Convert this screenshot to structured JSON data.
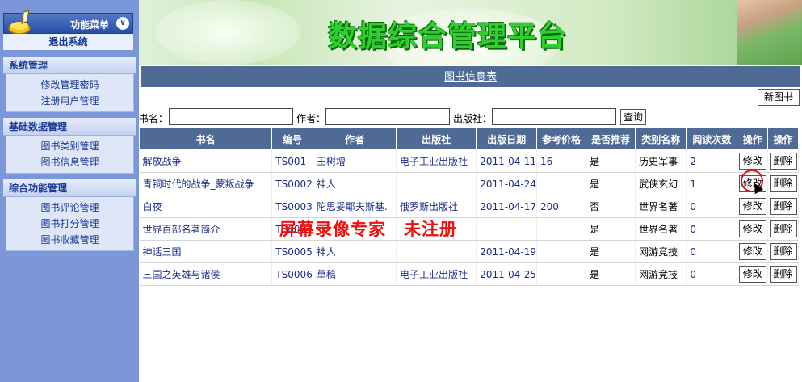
{
  "sidebar": {
    "menu_title": "功能菜单",
    "toggle_icon": "chevron-double-down",
    "logout_label": "退出系统",
    "sections": [
      {
        "title": "系统管理",
        "items": [
          "修改管理密码",
          "注册用户管理"
        ]
      },
      {
        "title": "基础数据管理",
        "items": [
          "图书类别管理",
          "图书信息管理"
        ]
      },
      {
        "title": "综合功能管理",
        "items": [
          "图书评论管理",
          "图书打分管理",
          "图书收藏管理"
        ]
      }
    ]
  },
  "banner": {
    "title": "数据综合管理平台"
  },
  "main": {
    "table_title": "图书信息表",
    "new_button_label": "新图书",
    "search": {
      "name_label": "书名：",
      "author_label": "作者：",
      "publisher_label": "出版社：",
      "name_value": "",
      "author_value": "",
      "publisher_value": "",
      "query_button_label": "查询"
    },
    "columns": [
      "书名",
      "编号",
      "作者",
      "出版社",
      "出版日期",
      "参考价格",
      "是否推荐",
      "类别名称",
      "阅读次数",
      "操作",
      "操作"
    ],
    "edit_label": "修改",
    "delete_label": "删除",
    "rows": [
      {
        "name": "解放战争",
        "id": "TS001",
        "author": "王树增",
        "publisher": "电子工业出版社",
        "date": "2011-04-11",
        "price": "16",
        "recommended": "是",
        "category": "历史军事",
        "reads": "2"
      },
      {
        "name": "青铜时代的战争_蒙叛战争",
        "id": "TS0002",
        "author": "神人",
        "publisher": "",
        "date": "2011-04-24",
        "price": "",
        "recommended": "是",
        "category": "武侠玄幻",
        "reads": "1"
      },
      {
        "name": "白夜",
        "id": "TS0003",
        "author": "陀思妥耶夫斯基.",
        "publisher": "俄罗斯出版社",
        "date": "2011-04-17",
        "price": "200",
        "recommended": "否",
        "category": "世界名著",
        "reads": "0"
      },
      {
        "name": "世界百部名著简介",
        "id": "TS0004",
        "author": "",
        "publisher": "",
        "date": "",
        "price": "",
        "recommended": "是",
        "category": "世界名著",
        "reads": "0"
      },
      {
        "name": "神话三国",
        "id": "TS0005",
        "author": "神人",
        "publisher": "",
        "date": "2011-04-19",
        "price": "",
        "recommended": "是",
        "category": "网游竞技",
        "reads": "0"
      },
      {
        "name": "三国之英雄与诸侯",
        "id": "TS0006",
        "author": "草稿",
        "publisher": "电子工业出版社",
        "date": "2011-04-25",
        "price": "",
        "recommended": "是",
        "category": "网游竞技",
        "reads": "0"
      }
    ]
  },
  "watermark": "屏幕录像专家　未注册",
  "colors": {
    "sidebar_bg": "#7b96d9",
    "header_bar": "#4f6a94",
    "banner_title": "#2fcf2f",
    "watermark": "#ee1111",
    "link_blue": "#1c2c8c"
  }
}
